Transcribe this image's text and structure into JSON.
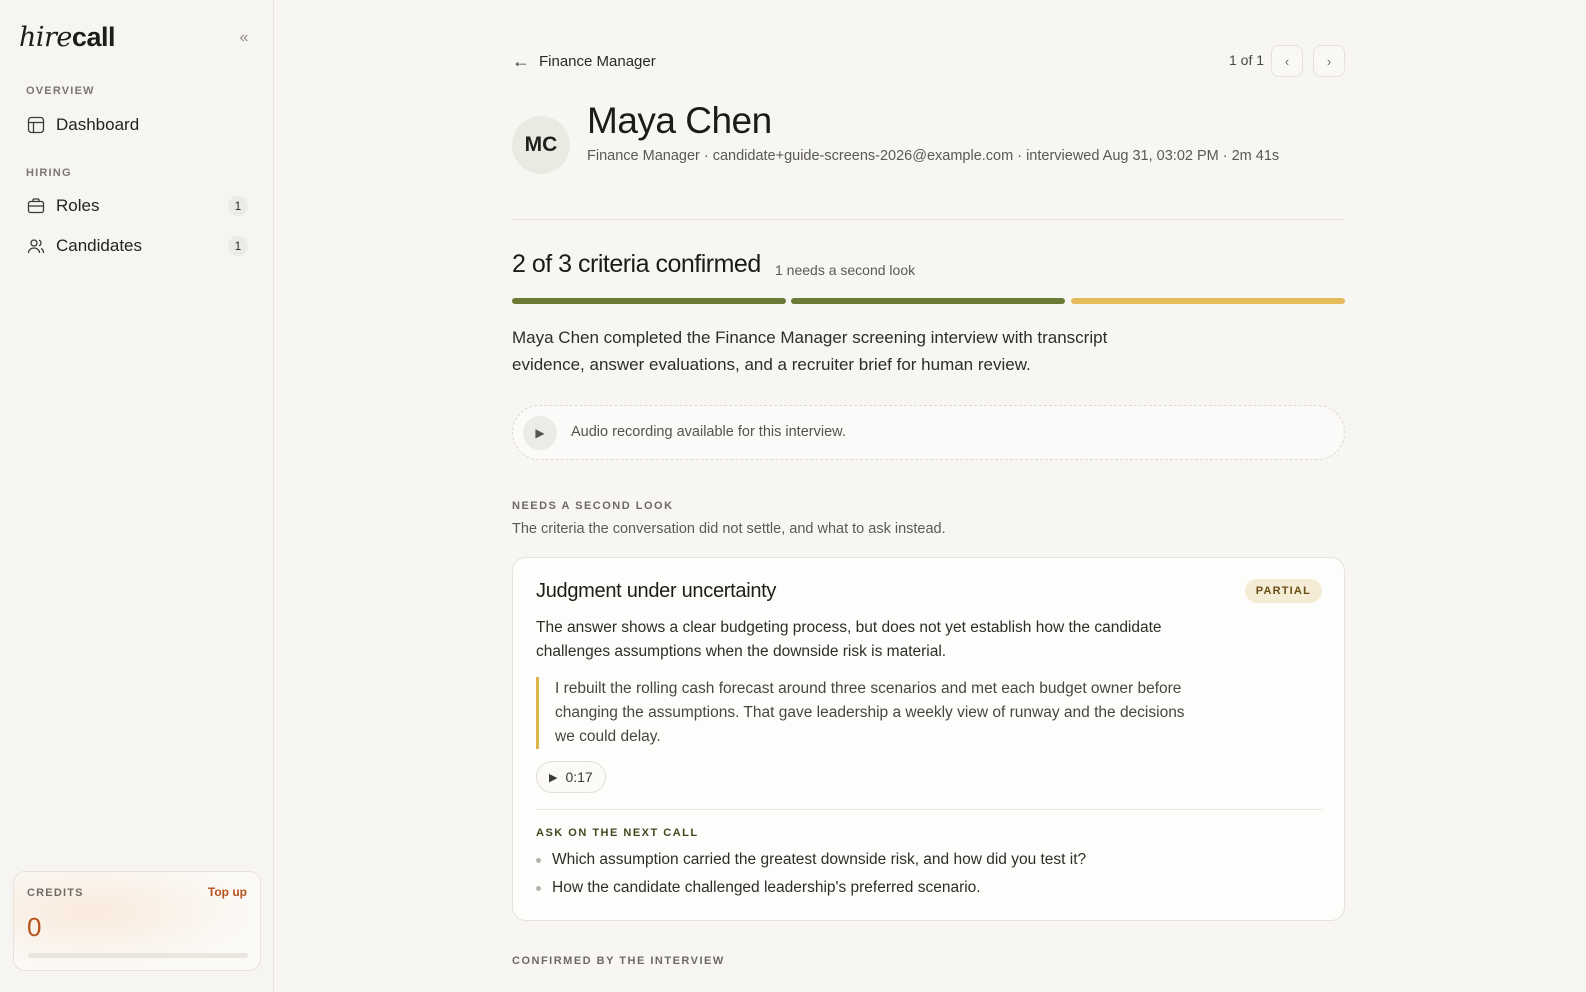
{
  "app": {
    "logo_hire": "hire",
    "logo_call": "call"
  },
  "sidebar": {
    "sections": [
      {
        "label": "OVERVIEW"
      },
      {
        "label": "HIRING"
      }
    ],
    "items": [
      {
        "label": "Dashboard",
        "icon": "layout-icon"
      },
      {
        "label": "Roles",
        "icon": "briefcase-icon",
        "count": "1"
      },
      {
        "label": "Candidates",
        "icon": "users-icon",
        "count": "1"
      }
    ],
    "credits": {
      "label": "CREDITS",
      "topup": "Top up",
      "value": "0",
      "fill": 0
    }
  },
  "header": {
    "back_label": "Finance Manager",
    "pager": "1 of 1"
  },
  "candidate": {
    "initials": "MC",
    "name": "Maya Chen",
    "meta": "Finance Manager · candidate+guide-screens-2026@example.com · interviewed Aug 31, 03:02 PM · 2m 41s"
  },
  "criteria": {
    "title": "2 of 3 criteria confirmed",
    "subtitle": "1 needs a second look",
    "segments": [
      {
        "status": "confirmed",
        "color": "#6b7a34"
      },
      {
        "status": "confirmed",
        "color": "#6b7a34"
      },
      {
        "status": "partial",
        "color": "#e5bc5c"
      }
    ]
  },
  "summary": "Maya Chen completed the Finance Manager screening interview with transcript evidence, answer evaluations, and a recruiter brief for human review.",
  "audio": {
    "text": "Audio recording available for this interview."
  },
  "second_look": {
    "label": "NEEDS A SECOND LOOK",
    "desc": "The criteria the conversation did not settle, and what to ask instead.",
    "card": {
      "title": "Judgment under uncertainty",
      "badge": "PARTIAL",
      "body": "The answer shows a clear budgeting process, but does not yet establish how the candidate challenges assumptions when the downside risk is material.",
      "quote": "I rebuilt the rolling cash forecast around three scenarios and met each budget owner before changing the assumptions. That gave leadership a weekly view of runway and the decisions we could delay.",
      "clip_time": "0:17",
      "ask_label": "ASK ON THE NEXT CALL",
      "questions": [
        "Which assumption carried the greatest downside risk, and how did you test it?",
        "How the candidate challenged leadership's preferred scenario."
      ]
    }
  },
  "confirmed": {
    "label": "CONFIRMED BY THE INTERVIEW"
  }
}
